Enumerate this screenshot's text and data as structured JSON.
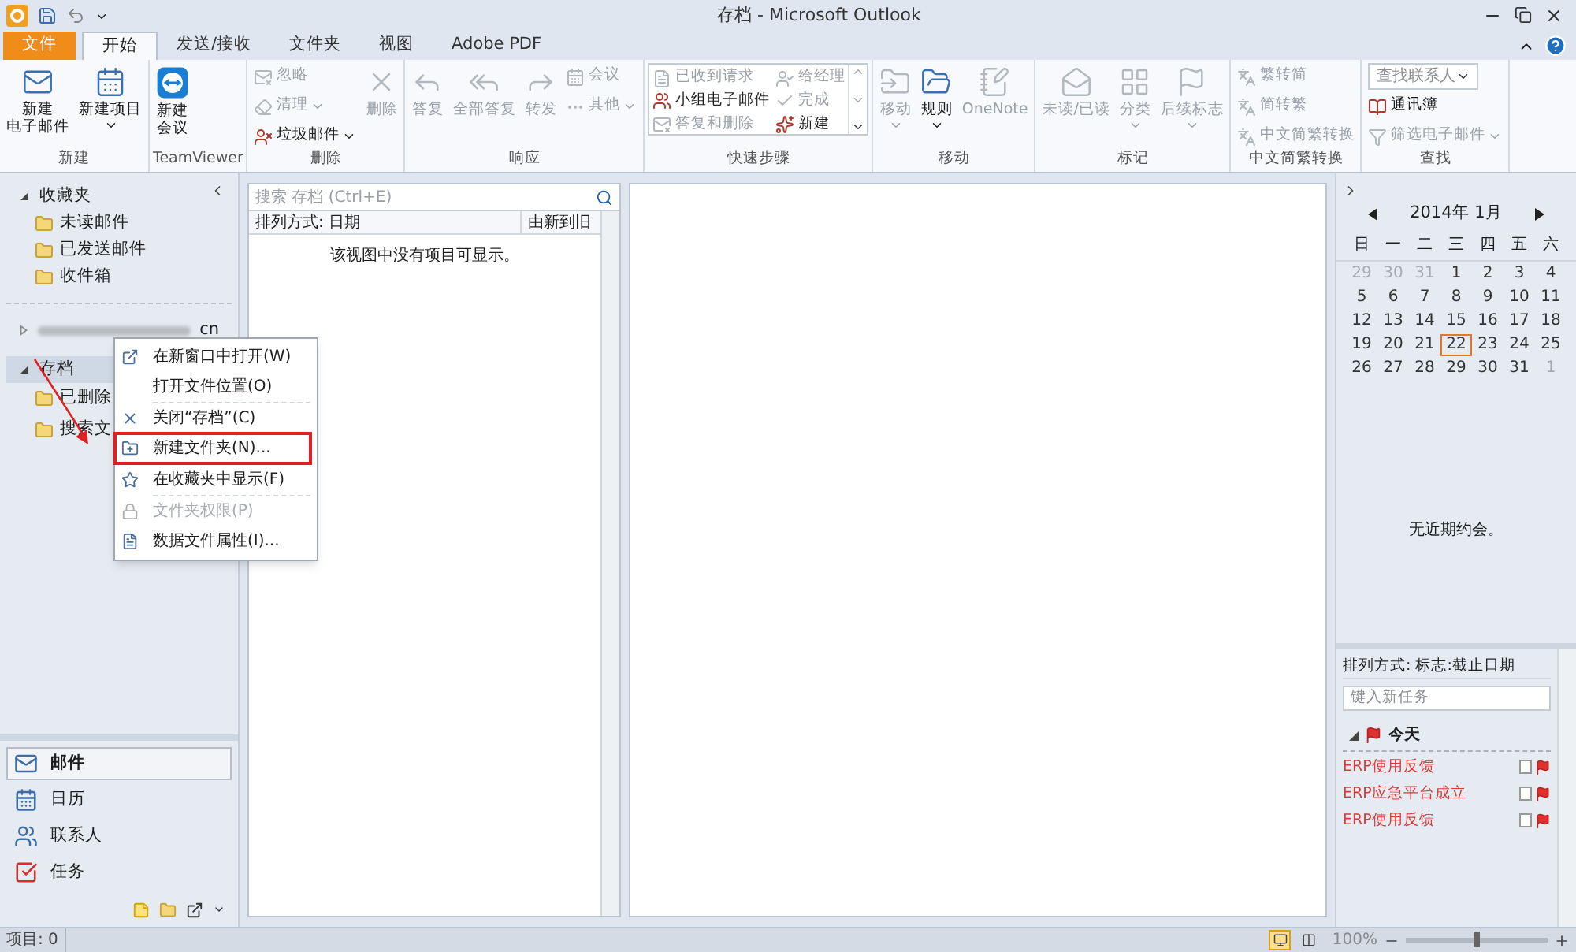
{
  "window": {
    "title": "存档 - Microsoft Outlook"
  },
  "tabs": [
    {
      "label": "文件",
      "kind": "backstage",
      "selected": false
    },
    {
      "label": "开始",
      "kind": "tab",
      "selected": true
    },
    {
      "label": "发送/接收",
      "kind": "tab",
      "selected": false
    },
    {
      "label": "文件夹",
      "kind": "tab",
      "selected": false
    },
    {
      "label": "视图",
      "kind": "tab",
      "selected": false
    },
    {
      "label": "Adobe PDF",
      "kind": "tab",
      "selected": false
    }
  ],
  "ribbon": [
    {
      "label": "新建",
      "columns": [
        {
          "kind": "large",
          "items": [
            {
              "lines": [
                "新建",
                "电子邮件"
              ],
              "disabled": false,
              "dropdown": false
            }
          ]
        },
        {
          "kind": "large",
          "items": [
            {
              "lines": [
                "新建项目"
              ],
              "disabled": false,
              "dropdown": true
            }
          ]
        }
      ]
    },
    {
      "label": "TeamViewer",
      "columns": [
        {
          "kind": "large",
          "items": [
            {
              "lines": [
                "新建",
                "会议"
              ],
              "disabled": false,
              "dropdown": false
            }
          ]
        }
      ]
    },
    {
      "label": "删除",
      "columns": [
        {
          "kind": "stack",
          "items": [
            {
              "lines": [
                "忽略"
              ],
              "disabled": true,
              "dropdown": false
            },
            {
              "lines": [
                "清理"
              ],
              "disabled": true,
              "dropdown": true
            },
            {
              "lines": [
                "垃圾邮件"
              ],
              "disabled": false,
              "dropdown": true
            }
          ]
        },
        {
          "kind": "large",
          "items": [
            {
              "lines": [
                "删除"
              ],
              "disabled": true,
              "dropdown": false
            }
          ]
        }
      ]
    },
    {
      "label": "响应",
      "columns": [
        {
          "kind": "large",
          "items": [
            {
              "lines": [
                "答复"
              ],
              "disabled": true,
              "dropdown": false
            }
          ]
        },
        {
          "kind": "large",
          "items": [
            {
              "lines": [
                "全部答复"
              ],
              "disabled": true,
              "dropdown": false
            }
          ]
        },
        {
          "kind": "large",
          "items": [
            {
              "lines": [
                "转发"
              ],
              "disabled": true,
              "dropdown": false
            }
          ]
        },
        {
          "kind": "stack",
          "items": [
            {
              "lines": [
                "会议"
              ],
              "disabled": true,
              "dropdown": false
            },
            {
              "lines": [
                "其他"
              ],
              "disabled": true,
              "dropdown": true
            }
          ]
        }
      ]
    },
    {
      "label": "快速步骤",
      "columns": [
        {
          "kind": "gallery",
          "items": [
            {
              "lines": [
                "已收到请求"
              ],
              "disabled": true,
              "dropdown": false
            },
            {
              "lines": [
                "小组电子邮件"
              ],
              "disabled": false,
              "dropdown": false
            },
            {
              "lines": [
                "答复和删除"
              ],
              "disabled": true,
              "dropdown": false
            },
            {
              "lines": [
                "给经理"
              ],
              "disabled": true,
              "dropdown": false
            },
            {
              "lines": [
                "完成"
              ],
              "disabled": true,
              "dropdown": false
            },
            {
              "lines": [
                "新建"
              ],
              "disabled": false,
              "dropdown": false
            }
          ]
        }
      ]
    },
    {
      "label": "移动",
      "columns": [
        {
          "kind": "large",
          "items": [
            {
              "lines": [
                "移动"
              ],
              "disabled": true,
              "dropdown": true
            }
          ]
        },
        {
          "kind": "large",
          "items": [
            {
              "lines": [
                "规则"
              ],
              "disabled": false,
              "dropdown": true
            }
          ]
        },
        {
          "kind": "large",
          "items": [
            {
              "lines": [
                "OneNote"
              ],
              "disabled": true,
              "dropdown": false
            }
          ]
        }
      ]
    },
    {
      "label": "标记",
      "columns": [
        {
          "kind": "large",
          "items": [
            {
              "lines": [
                "未读/已读"
              ],
              "disabled": true,
              "dropdown": false
            }
          ]
        },
        {
          "kind": "large",
          "items": [
            {
              "lines": [
                "分类"
              ],
              "disabled": true,
              "dropdown": true
            }
          ]
        },
        {
          "kind": "large",
          "items": [
            {
              "lines": [
                "后续标志"
              ],
              "disabled": true,
              "dropdown": true
            }
          ]
        }
      ]
    },
    {
      "label": "中文简繁转换",
      "columns": [
        {
          "kind": "stack",
          "items": [
            {
              "lines": [
                "繁转简"
              ],
              "disabled": true,
              "dropdown": false
            },
            {
              "lines": [
                "简转繁"
              ],
              "disabled": true,
              "dropdown": false
            },
            {
              "lines": [
                "中文简繁转换"
              ],
              "disabled": true,
              "dropdown": false
            }
          ]
        }
      ]
    },
    {
      "label": "查找",
      "columns": [
        {
          "kind": "stack",
          "items": [
            {
              "kind": "field",
              "placeholder": "查找联系人",
              "dropdown": true
            },
            {
              "lines": [
                "通讯簿"
              ],
              "disabled": false,
              "dropdown": false
            },
            {
              "lines": [
                "筛选电子邮件"
              ],
              "disabled": true,
              "dropdown": true
            }
          ]
        }
      ]
    }
  ],
  "navigation": {
    "tree": [
      {
        "label": "收藏夹",
        "kind": "folder",
        "expanded": true,
        "selected": false,
        "children": [
          {
            "label": "未读邮件",
            "selected": false
          },
          {
            "label": "已发送邮件",
            "selected": false
          },
          {
            "label": "收件箱",
            "selected": false
          }
        ]
      },
      {
        "label": "cn",
        "kind": "blurred",
        "expanded": false,
        "selected": false
      },
      {
        "label": "存档",
        "kind": "folder",
        "expanded": true,
        "selected": true,
        "children": [
          {
            "label": "已删除",
            "selected": false
          },
          {
            "label": "搜索文",
            "selected": false
          }
        ]
      }
    ],
    "context_menu": [
      [
        {
          "label": "在新窗口中打开(W)",
          "disabled": false,
          "annotated": false
        },
        {
          "label": "打开文件位置(O)",
          "disabled": false,
          "annotated": false
        }
      ],
      [
        {
          "label": "关闭“存档”(C)",
          "disabled": false,
          "annotated": false
        },
        {
          "label": "新建文件夹(N)...",
          "disabled": false,
          "annotated": true
        }
      ],
      [
        {
          "label": "在收藏夹中显示(F)",
          "disabled": false,
          "annotated": false
        }
      ],
      [
        {
          "label": "文件夹权限(P)",
          "disabled": true,
          "annotated": false
        },
        {
          "label": "数据文件属性(I)...",
          "disabled": false,
          "annotated": false
        }
      ]
    ],
    "modules": [
      {
        "label": "邮件",
        "selected": true
      },
      {
        "label": "日历",
        "selected": false
      },
      {
        "label": "联系人",
        "selected": false
      },
      {
        "label": "任务",
        "selected": false
      }
    ]
  },
  "message_list": {
    "search": {
      "placeholder": "搜索 存档 (Ctrl+E)"
    },
    "sort_label": "排列方式: 日期",
    "sort_order": "由新到旧",
    "empty_text": "该视图中没有项目可显示。"
  },
  "todo_bar": {
    "calendar": {
      "month": "2014年 1月",
      "weekdays": [
        "日",
        "一",
        "二",
        "三",
        "四",
        "五",
        "六"
      ],
      "weeks": [
        [
          {
            "d": "29",
            "dim": true,
            "today": false
          },
          {
            "d": "30",
            "dim": true,
            "today": false
          },
          {
            "d": "31",
            "dim": true,
            "today": false
          },
          {
            "d": "1",
            "dim": false,
            "today": false
          },
          {
            "d": "2",
            "dim": false,
            "today": false
          },
          {
            "d": "3",
            "dim": false,
            "today": false
          },
          {
            "d": "4",
            "dim": false,
            "today": false
          }
        ],
        [
          {
            "d": "5",
            "dim": false,
            "today": false
          },
          {
            "d": "6",
            "dim": false,
            "today": false
          },
          {
            "d": "7",
            "dim": false,
            "today": false
          },
          {
            "d": "8",
            "dim": false,
            "today": false
          },
          {
            "d": "9",
            "dim": false,
            "today": false
          },
          {
            "d": "10",
            "dim": false,
            "today": false
          },
          {
            "d": "11",
            "dim": false,
            "today": false
          }
        ],
        [
          {
            "d": "12",
            "dim": false,
            "today": false
          },
          {
            "d": "13",
            "dim": false,
            "today": false
          },
          {
            "d": "14",
            "dim": false,
            "today": false
          },
          {
            "d": "15",
            "dim": false,
            "today": false
          },
          {
            "d": "16",
            "dim": false,
            "today": false
          },
          {
            "d": "17",
            "dim": false,
            "today": false
          },
          {
            "d": "18",
            "dim": false,
            "today": false
          }
        ],
        [
          {
            "d": "19",
            "dim": false,
            "today": false
          },
          {
            "d": "20",
            "dim": false,
            "today": false
          },
          {
            "d": "21",
            "dim": false,
            "today": false
          },
          {
            "d": "22",
            "dim": false,
            "today": true
          },
          {
            "d": "23",
            "dim": false,
            "today": false
          },
          {
            "d": "24",
            "dim": false,
            "today": false
          },
          {
            "d": "25",
            "dim": false,
            "today": false
          }
        ],
        [
          {
            "d": "26",
            "dim": false,
            "today": false
          },
          {
            "d": "27",
            "dim": false,
            "today": false
          },
          {
            "d": "28",
            "dim": false,
            "today": false
          },
          {
            "d": "29",
            "dim": false,
            "today": false
          },
          {
            "d": "30",
            "dim": false,
            "today": false
          },
          {
            "d": "31",
            "dim": false,
            "today": false
          },
          {
            "d": "1",
            "dim": true,
            "today": false
          }
        ]
      ]
    },
    "appointments_text": "无近期约会。",
    "tasks": {
      "sort_label": "排列方式: 标志:截止日期",
      "new_task": {
        "placeholder": "键入新任务"
      },
      "group": "今天",
      "items": [
        {
          "label": "ERP使用反馈",
          "checked": false
        },
        {
          "label": "ERP应急平台成立",
          "checked": false
        },
        {
          "label": "ERP使用反馈",
          "checked": false
        }
      ]
    }
  },
  "status_bar": {
    "items": "项目: 0",
    "views": [
      {
        "selected": true
      },
      {
        "selected": false
      }
    ],
    "zoom": {
      "reading": "100%",
      "level": 0.5
    }
  }
}
